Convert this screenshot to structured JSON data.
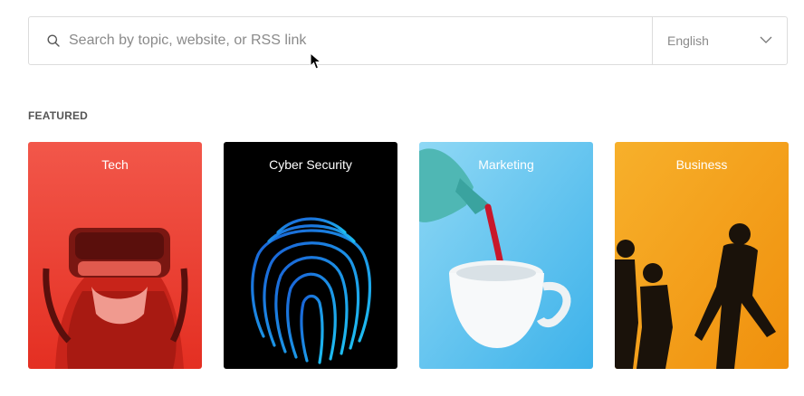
{
  "search": {
    "placeholder": "Search by topic, website, or RSS link",
    "icon": "search-icon"
  },
  "language_select": {
    "value": "English",
    "icon": "chevron-down-icon"
  },
  "featured": {
    "heading": "FEATURED",
    "cards": [
      {
        "label": "Tech",
        "accent": "#f0483a"
      },
      {
        "label": "Cyber Security",
        "accent": "#000000"
      },
      {
        "label": "Marketing",
        "accent": "#5fc3ee"
      },
      {
        "label": "Business",
        "accent": "#f6a21c"
      }
    ]
  },
  "colors": {
    "border": "#dcdcdc",
    "placeholder_text": "#8a8a8a",
    "heading_text": "#555555"
  }
}
